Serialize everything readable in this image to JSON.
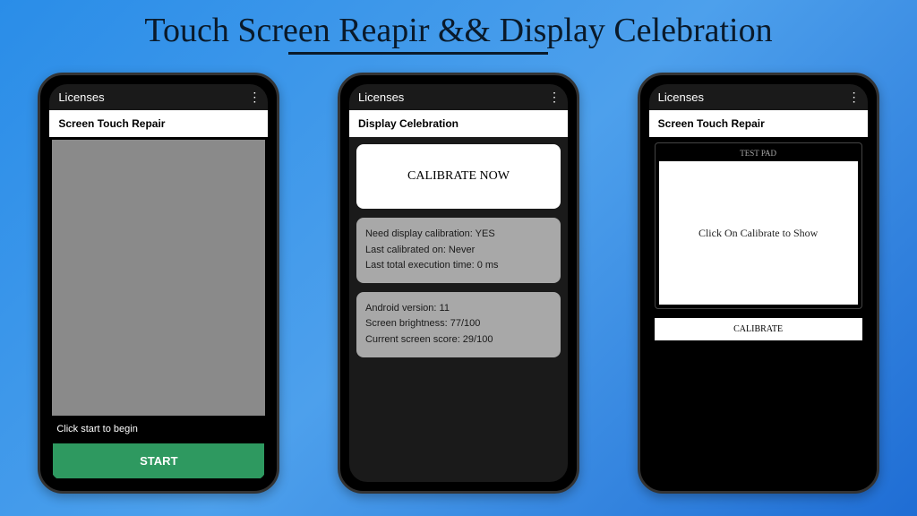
{
  "header": {
    "title": "Touch Screen Reapir && Display Celebration"
  },
  "phone1": {
    "status_label": "Licenses",
    "app_title": "Screen Touch Repair",
    "hint": "Click start to begin",
    "start_button": "START"
  },
  "phone2": {
    "status_label": "Licenses",
    "app_title": "Display Celebration",
    "calibrate_button": "CALIBRATE NOW",
    "card1_line1": "Need display calibration: YES",
    "card1_line2": "Last calibrated on: Never",
    "card1_line3": "Last total execution time: 0 ms",
    "card2_line1": "Android version: 11",
    "card2_line2": "Screen brightness: 77/100",
    "card2_line3": "Current screen score: 29/100"
  },
  "phone3": {
    "status_label": "Licenses",
    "app_title": "Screen Touch Repair",
    "test_pad_label": "TEST PAD",
    "test_pad_hint": "Click On Calibrate to Show",
    "calibrate_button": "CALIBRATE"
  }
}
